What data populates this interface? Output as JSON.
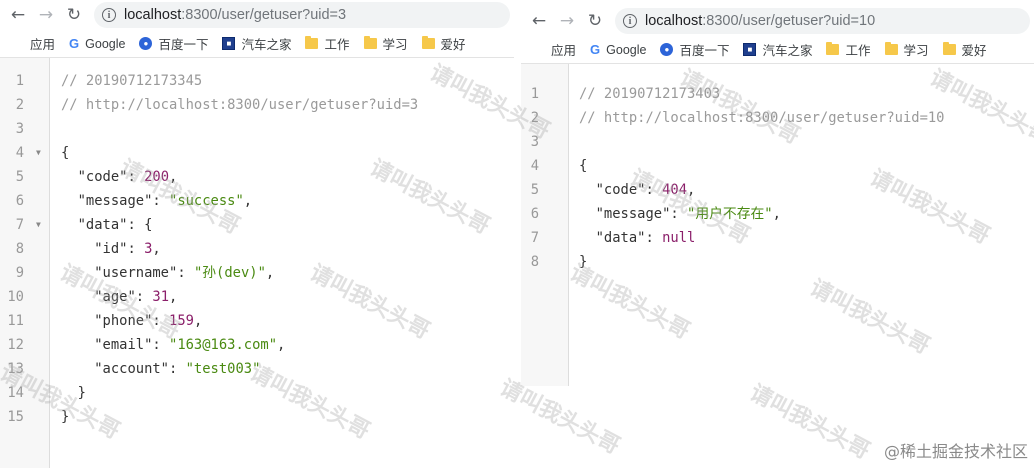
{
  "left": {
    "url_host": "localhost",
    "url_rest": ":8300/user/getuser?uid=3",
    "bookmarks": [
      "应用",
      "Google",
      "百度一下",
      "汽车之家",
      "工作",
      "学习",
      "爱好"
    ],
    "lines": [
      {
        "n": "1",
        "fold": false,
        "tokens": [
          {
            "c": "cm",
            "t": "// 20190712173345"
          }
        ]
      },
      {
        "n": "2",
        "fold": false,
        "tokens": [
          {
            "c": "cm",
            "t": "// http://localhost:8300/user/getuser?uid=3"
          }
        ]
      },
      {
        "n": "3",
        "fold": false,
        "tokens": []
      },
      {
        "n": "4",
        "fold": true,
        "tokens": [
          {
            "c": "punc",
            "t": "{"
          }
        ]
      },
      {
        "n": "5",
        "fold": false,
        "tokens": [
          {
            "c": "punc",
            "t": "  "
          },
          {
            "c": "key",
            "t": "\"code\""
          },
          {
            "c": "punc",
            "t": ": "
          },
          {
            "c": "num",
            "t": "200"
          },
          {
            "c": "punc",
            "t": ","
          }
        ]
      },
      {
        "n": "6",
        "fold": false,
        "tokens": [
          {
            "c": "punc",
            "t": "  "
          },
          {
            "c": "key",
            "t": "\"message\""
          },
          {
            "c": "punc",
            "t": ": "
          },
          {
            "c": "str",
            "t": "\"success\""
          },
          {
            "c": "punc",
            "t": ","
          }
        ]
      },
      {
        "n": "7",
        "fold": true,
        "tokens": [
          {
            "c": "punc",
            "t": "  "
          },
          {
            "c": "key",
            "t": "\"data\""
          },
          {
            "c": "punc",
            "t": ": {"
          }
        ]
      },
      {
        "n": "8",
        "fold": false,
        "tokens": [
          {
            "c": "punc",
            "t": "    "
          },
          {
            "c": "key",
            "t": "\"id\""
          },
          {
            "c": "punc",
            "t": ": "
          },
          {
            "c": "num",
            "t": "3"
          },
          {
            "c": "punc",
            "t": ","
          }
        ]
      },
      {
        "n": "9",
        "fold": false,
        "tokens": [
          {
            "c": "punc",
            "t": "    "
          },
          {
            "c": "key",
            "t": "\"username\""
          },
          {
            "c": "punc",
            "t": ": "
          },
          {
            "c": "str",
            "t": "\"孙(dev)\""
          },
          {
            "c": "punc",
            "t": ","
          }
        ]
      },
      {
        "n": "10",
        "fold": false,
        "tokens": [
          {
            "c": "punc",
            "t": "    "
          },
          {
            "c": "key",
            "t": "\"age\""
          },
          {
            "c": "punc",
            "t": ": "
          },
          {
            "c": "num",
            "t": "31"
          },
          {
            "c": "punc",
            "t": ","
          }
        ]
      },
      {
        "n": "11",
        "fold": false,
        "tokens": [
          {
            "c": "punc",
            "t": "    "
          },
          {
            "c": "key",
            "t": "\"phone\""
          },
          {
            "c": "punc",
            "t": ": "
          },
          {
            "c": "num",
            "t": "159"
          },
          {
            "c": "punc",
            "t": ","
          }
        ]
      },
      {
        "n": "12",
        "fold": false,
        "tokens": [
          {
            "c": "punc",
            "t": "    "
          },
          {
            "c": "key",
            "t": "\"email\""
          },
          {
            "c": "punc",
            "t": ": "
          },
          {
            "c": "str",
            "t": "\"163@163.com\""
          },
          {
            "c": "punc",
            "t": ","
          }
        ]
      },
      {
        "n": "13",
        "fold": false,
        "tokens": [
          {
            "c": "punc",
            "t": "    "
          },
          {
            "c": "key",
            "t": "\"account\""
          },
          {
            "c": "punc",
            "t": ": "
          },
          {
            "c": "str",
            "t": "\"test003\""
          }
        ]
      },
      {
        "n": "14",
        "fold": false,
        "tokens": [
          {
            "c": "punc",
            "t": "  }"
          }
        ]
      },
      {
        "n": "15",
        "fold": false,
        "tokens": [
          {
            "c": "punc",
            "t": "}"
          }
        ]
      }
    ]
  },
  "right": {
    "url_host": "localhost",
    "url_rest": ":8300/user/getuser?uid=10",
    "bookmarks": [
      "应用",
      "Google",
      "百度一下",
      "汽车之家",
      "工作",
      "学习",
      "爱好"
    ],
    "lines": [
      {
        "n": "1",
        "fold": false,
        "tokens": [
          {
            "c": "cm",
            "t": "// 20190712173403"
          }
        ]
      },
      {
        "n": "2",
        "fold": false,
        "tokens": [
          {
            "c": "cm",
            "t": "// http://localhost:8300/user/getuser?uid=10"
          }
        ]
      },
      {
        "n": "3",
        "fold": false,
        "tokens": []
      },
      {
        "n": "4",
        "fold": true,
        "tokens": [
          {
            "c": "punc",
            "t": "{"
          }
        ]
      },
      {
        "n": "5",
        "fold": false,
        "tokens": [
          {
            "c": "punc",
            "t": "  "
          },
          {
            "c": "key",
            "t": "\"code\""
          },
          {
            "c": "punc",
            "t": ": "
          },
          {
            "c": "num",
            "t": "404"
          },
          {
            "c": "punc",
            "t": ","
          }
        ]
      },
      {
        "n": "6",
        "fold": false,
        "tokens": [
          {
            "c": "punc",
            "t": "  "
          },
          {
            "c": "key",
            "t": "\"message\""
          },
          {
            "c": "punc",
            "t": ": "
          },
          {
            "c": "str",
            "t": "\"用户不存在\""
          },
          {
            "c": "punc",
            "t": ","
          }
        ]
      },
      {
        "n": "7",
        "fold": false,
        "tokens": [
          {
            "c": "punc",
            "t": "  "
          },
          {
            "c": "key",
            "t": "\"data\""
          },
          {
            "c": "punc",
            "t": ": "
          },
          {
            "c": "kw",
            "t": "null"
          }
        ]
      },
      {
        "n": "8",
        "fold": false,
        "tokens": [
          {
            "c": "punc",
            "t": "}"
          }
        ]
      }
    ]
  },
  "watermark": "请叫我头头哥",
  "credit": "@稀土掘金技术社区"
}
